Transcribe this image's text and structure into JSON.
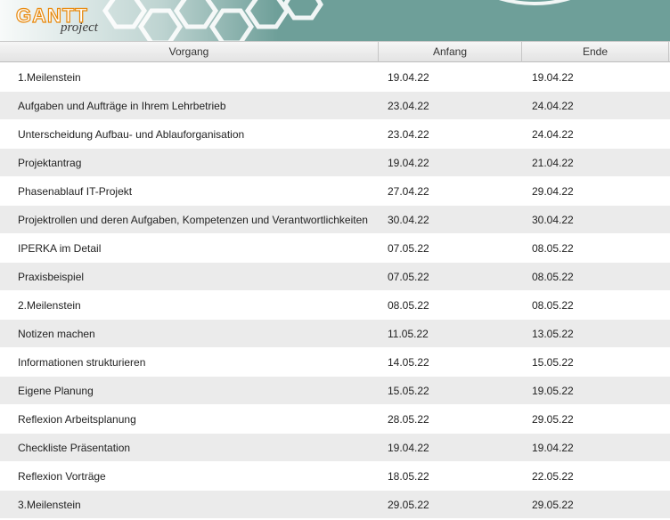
{
  "app": {
    "logo_brand": "GANTT",
    "logo_sub": "project"
  },
  "table": {
    "headers": {
      "task": "Vorgang",
      "start": "Anfang",
      "end": "Ende"
    },
    "rows": [
      {
        "task": "1.Meilenstein",
        "start": "19.04.22",
        "end": "19.04.22"
      },
      {
        "task": "Aufgaben und Aufträge in Ihrem Lehrbetrieb",
        "start": "23.04.22",
        "end": "24.04.22"
      },
      {
        "task": "Unterscheidung Aufbau- und Ablauforganisation",
        "start": "23.04.22",
        "end": "24.04.22"
      },
      {
        "task": "Projektantrag",
        "start": "19.04.22",
        "end": "21.04.22"
      },
      {
        "task": "Phasenablauf IT-Projekt",
        "start": "27.04.22",
        "end": "29.04.22"
      },
      {
        "task": "Projektrollen und deren Aufgaben, Kompetenzen und Verantwortlichkeiten",
        "start": "30.04.22",
        "end": "30.04.22"
      },
      {
        "task": "IPERKA im Detail",
        "start": "07.05.22",
        "end": "08.05.22"
      },
      {
        "task": "Praxisbeispiel",
        "start": "07.05.22",
        "end": "08.05.22"
      },
      {
        "task": "2.Meilenstein",
        "start": "08.05.22",
        "end": "08.05.22"
      },
      {
        "task": "Notizen machen",
        "start": "11.05.22",
        "end": "13.05.22"
      },
      {
        "task": "Informationen strukturieren",
        "start": "14.05.22",
        "end": "15.05.22"
      },
      {
        "task": "Eigene Planung",
        "start": "15.05.22",
        "end": "19.05.22"
      },
      {
        "task": "Reflexion Arbeitsplanung",
        "start": "28.05.22",
        "end": "29.05.22"
      },
      {
        "task": "Checkliste Präsentation",
        "start": "19.04.22",
        "end": "19.04.22"
      },
      {
        "task": "Reflexion Vorträge",
        "start": "18.05.22",
        "end": "22.05.22"
      },
      {
        "task": "3.Meilenstein",
        "start": "29.05.22",
        "end": "29.05.22"
      }
    ]
  },
  "colors": {
    "banner": "#6e9f99",
    "logo_orange": "#e8890c",
    "row_alt": "#ebebeb"
  }
}
